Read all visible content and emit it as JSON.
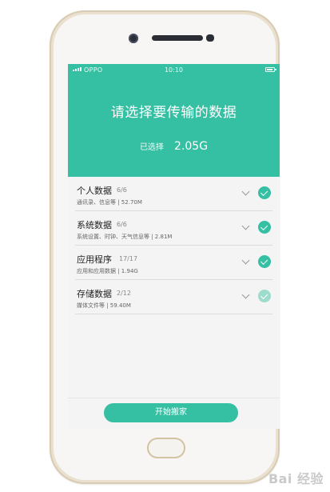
{
  "statusbar": {
    "carrier": "OPPO",
    "time": "10:10"
  },
  "header": {
    "title": "请选择要传输的数据",
    "selected_label": "已选择",
    "selected_size": "2.05G"
  },
  "items": [
    {
      "name": "个人数据",
      "count": "6/6",
      "desc": "通讯录、信息等 | 52.70M",
      "checked": "full"
    },
    {
      "name": "系统数据",
      "count": "6/6",
      "desc": "系统设置、时钟、天气信息等 | 2.81M",
      "checked": "full"
    },
    {
      "name": "应用程序",
      "count": "17/17",
      "desc": "应用和应用数据 | 1.94G",
      "checked": "full"
    },
    {
      "name": "存储数据",
      "count": "2/12",
      "desc": "媒体文件等 | 59.40M",
      "checked": "partial"
    }
  ],
  "footer": {
    "start_button": "开始搬家"
  },
  "watermark": "Bai 经验",
  "colors": {
    "accent": "#35bfa3",
    "accent_light": "#9ddccd",
    "phone_frame": "#e9e0cf"
  }
}
